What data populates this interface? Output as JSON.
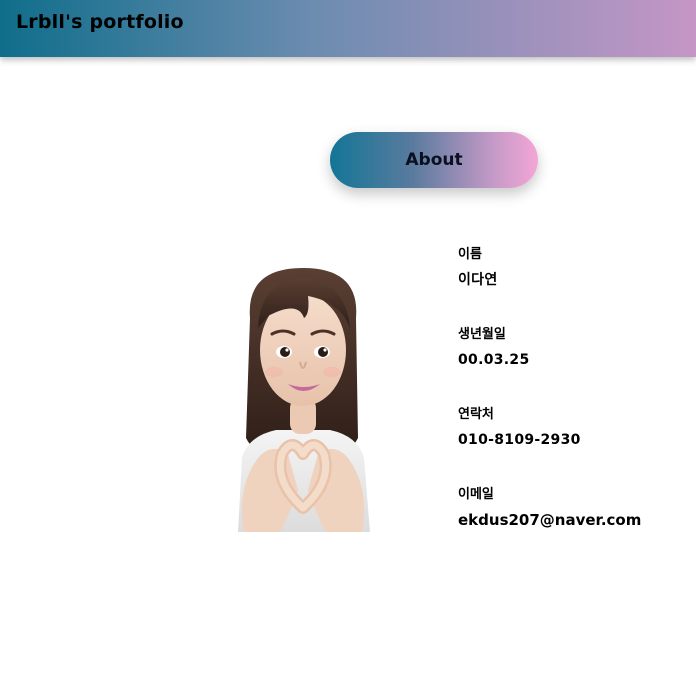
{
  "header": {
    "title": "Lrbll's portfolio"
  },
  "about": {
    "title": "About",
    "items": [
      {
        "label": "이름",
        "value": "이다연"
      },
      {
        "label": "생년월일",
        "value": "00.03.25"
      },
      {
        "label": "연락처",
        "value": "010-8109-2930"
      },
      {
        "label": "이메일",
        "value": "ekdus207@naver.com"
      }
    ]
  },
  "colors": {
    "header_gradient": [
      "#0f6e8b",
      "#c596c6"
    ],
    "pill_gradient": [
      "#137696",
      "#f3a6d6"
    ]
  }
}
